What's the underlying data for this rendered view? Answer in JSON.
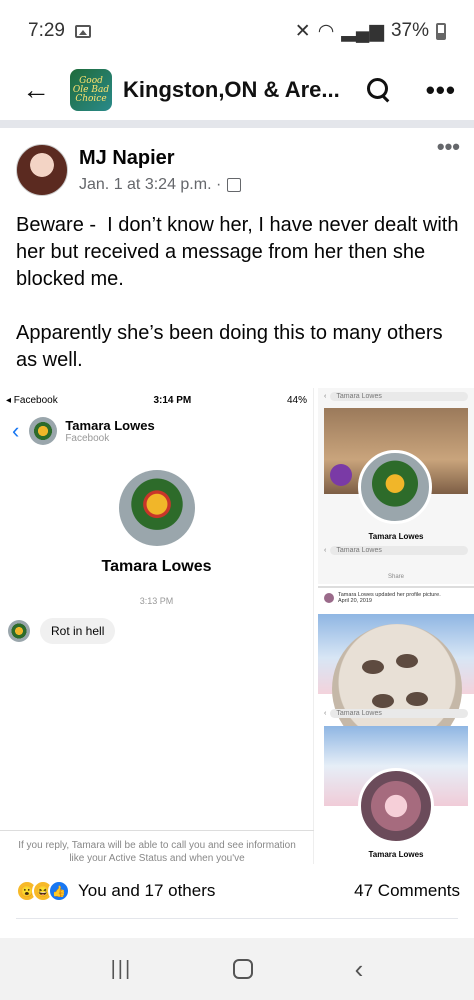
{
  "status_bar": {
    "time": "7:29",
    "battery": "37%"
  },
  "header": {
    "group_name": "Kingston,ON & Are...",
    "logo_text": "Good Ole Bad Choice"
  },
  "post": {
    "author": "MJ Napier",
    "timestamp": "Jan. 1 at 3:24 p.m. ·",
    "paragraphs": [
      "Beware -  I don’t know her, I have never dealt with her but received a message from her then she blocked me.",
      "Apparently she’s been doing this to many others as well."
    ]
  },
  "screenshot_left": {
    "carrier": "◂ Facebook",
    "clock": "3:14 PM",
    "battery": "44%",
    "contact_name": "Tamara Lowes",
    "contact_sub": "Facebook",
    "profile_name": "Tamara Lowes",
    "msg_time": "3:13 PM",
    "message": "Rot in hell",
    "reply_note": "If you reply, Tamara will be able to call you and see information like your Active Status and when you've"
  },
  "screenshot_right": {
    "search_top": "Tamara Lowes",
    "profile_name_a": "Tamara Lowes",
    "search_mid": "Tamara Lowes",
    "share": "Share",
    "update_text": "Tamara Lowes updated her profile picture.",
    "update_date": "April 20, 2019",
    "search_b": "Tamara Lowes",
    "profile_name_b": "Tamara Lowes"
  },
  "footer": {
    "reactions_text": "You and 17 others",
    "comments": "47 Comments"
  }
}
